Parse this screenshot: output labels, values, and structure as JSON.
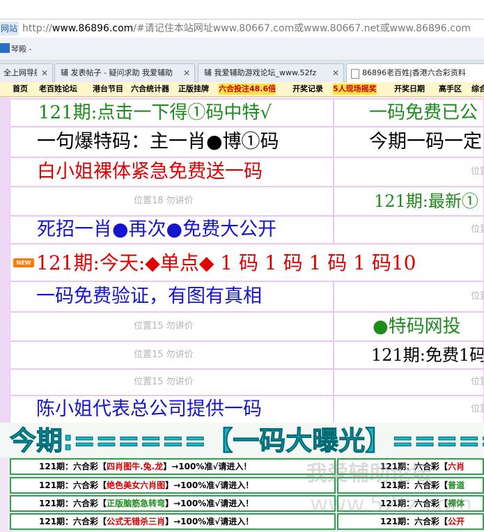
{
  "browser": {
    "address_site_label": "网站",
    "address_scheme": "http://",
    "address_host": "www.86896.com",
    "address_rest": "/#请记住本站网址www.80667.com或www.80667.net或www.86896.com",
    "bookmark_label": "琴殿 -",
    "tabs": [
      {
        "label": "全上网导航",
        "close": "✕"
      },
      {
        "label": "辅 发表帖子 - 疑问求助 我爱辅助",
        "close": "✕"
      },
      {
        "label": "辅 我爱辅助游戏论坛_www.52fz",
        "close": "✕"
      },
      {
        "label": "86896老百姓|香港六合彩资料",
        "close": "✕"
      }
    ]
  },
  "nav": [
    {
      "label": "首页",
      "color": "#000000"
    },
    {
      "label": "老百姓论坛",
      "color": "#000000"
    },
    {
      "label": "港台节目",
      "color": "#000000"
    },
    {
      "label": "六合统计器",
      "color": "#000000"
    },
    {
      "label": "正版挂牌",
      "color": "#000000"
    },
    {
      "label": "六合投注48.6倍",
      "color": "#d40000"
    },
    {
      "label": "开奖记录",
      "color": "#000000"
    },
    {
      "label": "5人现场摇奖",
      "color": "#d40000"
    },
    {
      "label": "开奖日期",
      "color": "#000000"
    },
    {
      "label": "高手区",
      "color": "#000000"
    },
    {
      "label": "综合",
      "color": "#000000"
    }
  ],
  "rows": [
    {
      "left": "121期:点击一下得①码中特√",
      "left_color": "#1c8c1c",
      "right": "一码免费已公",
      "right_color": "#1c8c1c"
    },
    {
      "left": "一句爆特码：主一肖●博①码",
      "left_color": "#000000",
      "right": "今期一码一定",
      "right_color": "#000000"
    },
    {
      "left": "白小姐裸体紧急免费送一码",
      "left_color": "#e00000",
      "right": "位置",
      "right_color": "#b5b5b5"
    },
    {
      "left": "位置18 勿讲价",
      "left_color": "#b5b5b5",
      "right": "121期:最新①",
      "right_color": "#1c8c1c"
    },
    {
      "left": "死招一肖●再次●免费大公开",
      "left_color": "#1515d0",
      "right": "位置",
      "right_color": "#b5b5b5"
    },
    {
      "full": "121期:今天:◆单点◆ 1 码 1 码 1 码 1 码10",
      "full_color": "#e00000",
      "new_badge": "NEW"
    },
    {
      "left": "一码免费验证，有图有真相",
      "left_color": "#1515d0",
      "right": "位置",
      "right_color": "#b5b5b5"
    },
    {
      "left": "位置15 勿讲价",
      "left_color": "#b5b5b5",
      "right": "●特码网投",
      "right_color": "#1c8c1c"
    },
    {
      "left": "位置15 勿讲价",
      "left_color": "#b5b5b5",
      "right": "121期:免费1码",
      "right_color": "#000000"
    },
    {
      "left": "位置15 勿讲价",
      "left_color": "#b5b5b5",
      "right": "位置",
      "right_color": "#b5b5b5"
    },
    {
      "left": "陈小姐代表总公司提供一码",
      "left_color": "#1515d0",
      "right": "位置",
      "right_color": "#b5b5b5"
    }
  ],
  "banner": "今期:======【一码大曝光】=====",
  "links": [
    {
      "prefix": "121期：六合彩【",
      "highlight": "四肖图牛.兔.龙",
      "suffix": "】→100%准√请进入！",
      "highlight_color": "#d40000",
      "right_prefix": "121期：六合彩【",
      "right_highlight": "六肖",
      "right_color": "#d40000"
    },
    {
      "prefix": "121期：六合彩【",
      "highlight": "绝色美女六肖图",
      "suffix": "】→100%准√请进入！",
      "highlight_color": "#d40000",
      "right_prefix": "121期：六合彩【",
      "right_highlight": "普道",
      "right_color": "#1c8c1c"
    },
    {
      "prefix": "121期：六合彩【",
      "highlight": "正版脑筋急转弯",
      "suffix": "】→100%准√请进入！",
      "highlight_color": "#1c8c1c",
      "right_prefix": "121期：六合彩【",
      "right_highlight": "裸体",
      "right_color": "#1c8c1c"
    },
    {
      "prefix": "121期：六合彩【",
      "highlight": "公式无错杀三肖",
      "suffix": "】→100%准√请进入！",
      "highlight_color": "#d40000",
      "right_prefix": "121期：六合彩【",
      "right_highlight": "公开",
      "right_color": "#d40000"
    }
  ],
  "watermark": "我爱辅助论坛",
  "watermark2": "www.52fz.com"
}
